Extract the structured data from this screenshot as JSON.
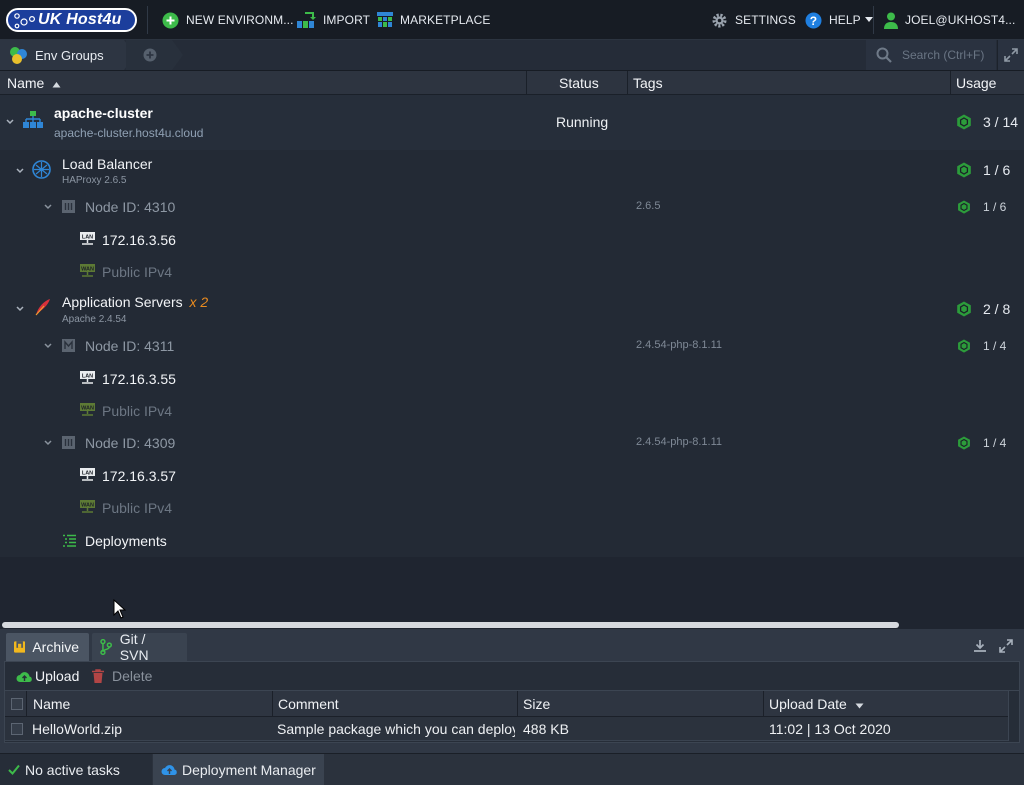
{
  "topbar": {
    "logo_text": "UK Host4u",
    "new_env_label": "NEW ENVIRONM...",
    "import_label": "IMPORT",
    "marketplace_label": "MARKETPLACE",
    "settings_label": "SETTINGS",
    "help_label": "HELP",
    "user_label": "JOEL@UKHOST4..."
  },
  "breadcrumb": {
    "env_groups_label": "Env Groups",
    "search_placeholder": "Search (Ctrl+F)"
  },
  "columns": {
    "name": "Name",
    "status": "Status",
    "tags": "Tags",
    "usage": "Usage"
  },
  "environment": {
    "name": "apache-cluster",
    "domain": "apache-cluster.host4u.cloud",
    "status": "Running",
    "usage": "3 / 14",
    "layers": [
      {
        "name": "Load Balancer",
        "version": "HAProxy 2.6.5",
        "multiplier": "",
        "usage": "1 / 6",
        "nodes": [
          {
            "label": "Node ID: 4310",
            "tag": "2.6.5",
            "usage": "1 / 6",
            "ip": "172.16.3.56",
            "public": "Public IPv4"
          }
        ]
      },
      {
        "name": "Application Servers",
        "version": "Apache 2.4.54",
        "multiplier": "x 2",
        "usage": "2 / 8",
        "nodes": [
          {
            "label": "Node ID: 4311",
            "tag": "2.4.54-php-8.1.11",
            "usage": "1 / 4",
            "ip": "172.16.3.55",
            "public": "Public IPv4"
          },
          {
            "label": "Node ID: 4309",
            "tag": "2.4.54-php-8.1.11",
            "usage": "1 / 4",
            "ip": "172.16.3.57",
            "public": "Public IPv4"
          }
        ]
      }
    ],
    "deployments_label": "Deployments"
  },
  "bottom_panel": {
    "tabs": [
      "Archive",
      "Git / SVN"
    ],
    "upload_label": "Upload",
    "delete_label": "Delete",
    "grid_headers": [
      "Name",
      "Comment",
      "Size",
      "Upload Date"
    ],
    "rows": [
      {
        "name": "HelloWorld.zip",
        "comment": "Sample package which you can deploy...",
        "size": "488 KB",
        "date": "11:02 | 13 Oct 2020"
      }
    ]
  },
  "statusbar": {
    "tasks_label": "No active tasks",
    "deployment_manager_label": "Deployment Manager"
  },
  "colors": {
    "accent_green": "#3dbb4a",
    "accent_orange": "#e98b1f",
    "brand_blue": "#1c3e9c",
    "help_blue": "#1f7fe0"
  }
}
